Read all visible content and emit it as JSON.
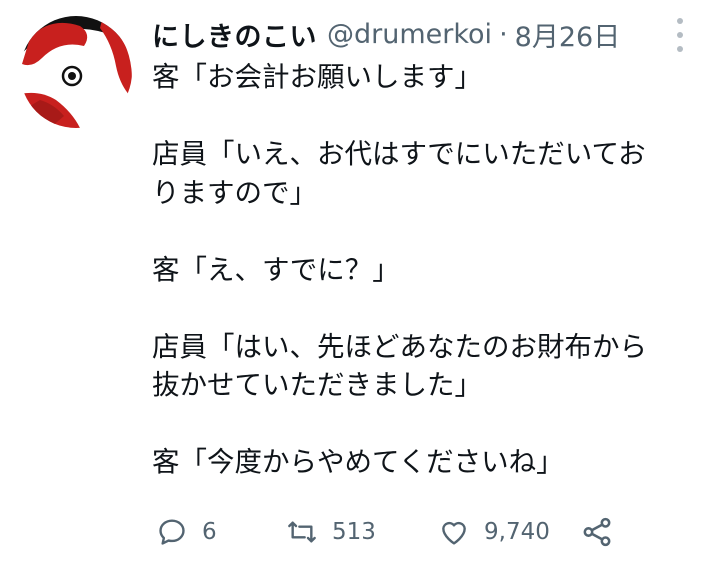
{
  "tweet": {
    "display_name": "にしきのこい",
    "handle": "@drumerkoi",
    "separator": "·",
    "date": "8月26日",
    "lines": [
      "客「お会計お願いします」",
      "",
      "店員「いえ、お代はすでにいただいてお",
      "りますので」",
      "",
      "客「え、すでに？」",
      "",
      "店員「はい、先ほどあなたのお財布から",
      "抜かせていただきました」",
      "",
      "客「今度からやめてくださいね」"
    ]
  },
  "actions": {
    "reply_count": "6",
    "retweet_count": "513",
    "like_count": "9,740"
  },
  "colors": {
    "text": "#0f1419",
    "secondary": "#536471",
    "avatar_red": "#c8201e",
    "avatar_black": "#111111"
  },
  "icons": [
    "more-icon",
    "reply-icon",
    "retweet-icon",
    "like-icon",
    "share-icon"
  ]
}
